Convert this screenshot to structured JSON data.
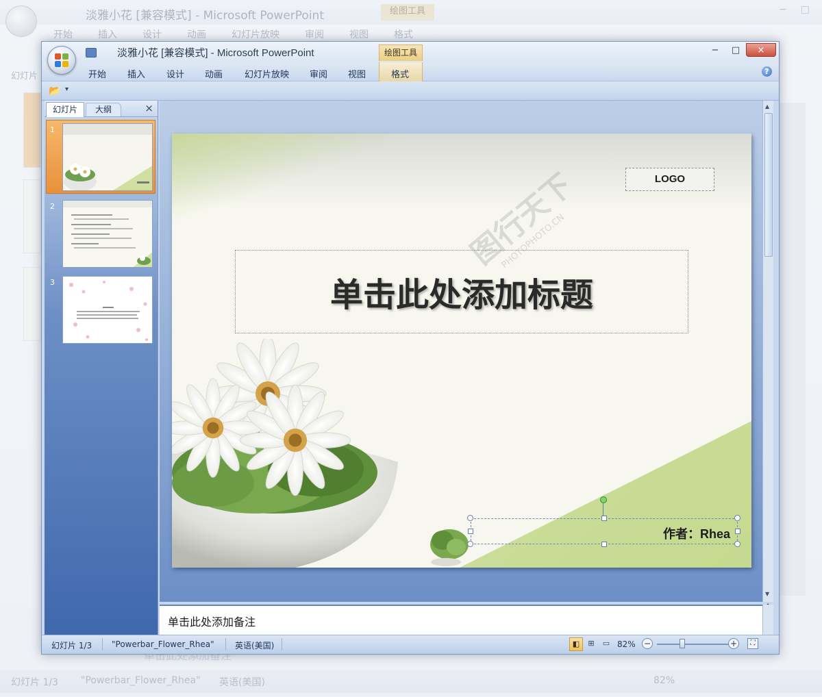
{
  "window": {
    "title": "淡雅小花 [兼容模式] - Microsoft PowerPoint",
    "context_tab_title": "绘图工具",
    "controls": {
      "minimize": "−",
      "maximize": "□",
      "close": "×"
    }
  },
  "ribbon": {
    "tabs": [
      "开始",
      "插入",
      "设计",
      "动画",
      "幻灯片放映",
      "审阅",
      "视图",
      "格式"
    ],
    "help": "?"
  },
  "panel": {
    "tabs": {
      "slides": "幻灯片",
      "outline": "大纲"
    },
    "close": "×",
    "thumbnails": [
      {
        "number": "1",
        "selected": true
      },
      {
        "number": "2",
        "selected": false
      },
      {
        "number": "3",
        "selected": false
      }
    ]
  },
  "slide": {
    "logo": "LOGO",
    "title_placeholder": "单击此处添加标题",
    "author": "作者：Rhea",
    "colors": {
      "background": "#f7f7ef",
      "green_accent": "#c5d98f"
    }
  },
  "notes": {
    "placeholder": "单击此处添加备注"
  },
  "status": {
    "slide_counter": "幻灯片 1/3",
    "theme": "\"Powerbar_Flower_Rhea\"",
    "language": "英语(美国)",
    "zoom": "82%",
    "zoom_fraction": 0.35
  },
  "background_window": {
    "title": "淡雅小花 [兼容模式] - Microsoft PowerPoint",
    "context_tab_title": "绘图工具",
    "tabs": [
      "开始",
      "插入",
      "设计",
      "动画",
      "幻灯片放映",
      "审阅",
      "视图",
      "格式"
    ],
    "slides_label": "幻灯片",
    "notes": "单击此处添加备注",
    "slide_counter": "幻灯片 1/3",
    "theme": "\"Powerbar_Flower_Rhea\"",
    "language": "英语(美国)",
    "zoom": "82%"
  },
  "watermark": {
    "text": "图行天下",
    "sub": "PHOTOPHOTO.CN"
  }
}
